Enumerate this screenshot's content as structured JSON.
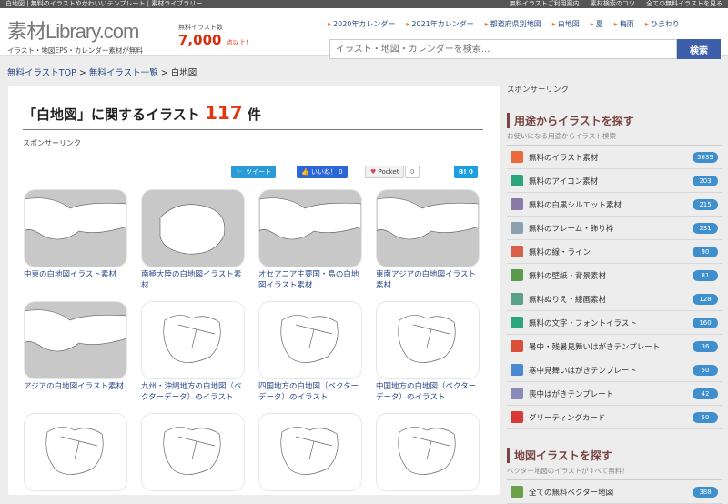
{
  "topbar": {
    "left": "白地図 | 無料のイラストやかわいいテンプレート | 素材ライブラリー",
    "right": [
      "無料イラストご利用案内",
      "素材検索のコツ",
      "全ての無料イラストを見る"
    ]
  },
  "logo": {
    "title": "素材Library.com",
    "subtitle": "イラスト・地図EPS・カレンダー素材が無料"
  },
  "count": {
    "label": "無料イラスト数",
    "number": "7,000",
    "suffix": "点以上！"
  },
  "quick_links": [
    "2020年カレンダー",
    "2021年カレンダー",
    "都道府県別地図",
    "白地図",
    "夏",
    "梅雨",
    "ひまわり"
  ],
  "search": {
    "placeholder": "イラスト・地図・カレンダーを検索...",
    "button": "検索"
  },
  "breadcrumb": {
    "items": [
      "無料イラストTOP",
      "無料イラスト一覧"
    ],
    "current": "白地図",
    "sep": ">"
  },
  "heading": {
    "prefix": "「白地図」に関するイラスト",
    "count": "117",
    "suffix": "件"
  },
  "sponsored": "スポンサーリンク",
  "share": {
    "tweet": "ツイート",
    "like": "いいね！ 0",
    "pocket": "Pocket",
    "pocket_count": "0",
    "hatena": "B! 0"
  },
  "cards": [
    {
      "caption": "中東の白地図イラスト素材"
    },
    {
      "caption": "南極大陸の白地図イラスト素材"
    },
    {
      "caption": "オセアニア主要国・島の白地図イラスト素材"
    },
    {
      "caption": "東南アジアの白地図イラスト素材"
    },
    {
      "caption": "アジアの白地図イラスト素材"
    },
    {
      "caption": "九州・沖縄地方の白地図（ベクターデータ）のイラスト"
    },
    {
      "caption": "四国地方の白地図（ベクターデータ）のイラスト"
    },
    {
      "caption": "中国地方の白地図（ベクターデータ）のイラスト"
    },
    {
      "caption": ""
    },
    {
      "caption": ""
    },
    {
      "caption": ""
    },
    {
      "caption": ""
    }
  ],
  "sidebar": {
    "sponsored": "スポンサーリンク",
    "section1": {
      "title": "用途からイラストを探す",
      "sub": "お使いになる用途からイラスト検索",
      "items": [
        {
          "label": "無料のイラスト素材",
          "count": "5639",
          "color": "#e96a3a"
        },
        {
          "label": "無料のアイコン素材",
          "count": "203",
          "color": "#2aa67a"
        },
        {
          "label": "無料の白黒シルエット素材",
          "count": "215",
          "color": "#8a7aa8"
        },
        {
          "label": "無料のフレーム・飾り枠",
          "count": "231",
          "color": "#8aa0b0"
        },
        {
          "label": "無料の線・ライン",
          "count": "90",
          "color": "#d8604a"
        },
        {
          "label": "無料の壁紙・背景素材",
          "count": "81",
          "color": "#5a9a4a"
        },
        {
          "label": "無料ぬりえ・線画素材",
          "count": "128",
          "color": "#5aa08a"
        },
        {
          "label": "無料の文字・フォントイラスト",
          "count": "160",
          "color": "#2aa67a"
        },
        {
          "label": "暑中・残暑見舞いはがきテンプレート",
          "count": "36",
          "color": "#d8503a"
        },
        {
          "label": "寒中見舞いはがきテンプレート",
          "count": "50",
          "color": "#4a8ad0"
        },
        {
          "label": "喪中はがきテンプレート",
          "count": "42",
          "color": "#8a8ab8"
        },
        {
          "label": "グリーティングカード",
          "count": "50",
          "color": "#d83a3a"
        }
      ]
    },
    "section2": {
      "title": "地図イラストを探す",
      "sub": "ベクター地図のイラストがすべて無料！",
      "items": [
        {
          "label": "全ての無料ベクター地図",
          "count": "388",
          "color": "#6aa04a"
        }
      ]
    }
  }
}
